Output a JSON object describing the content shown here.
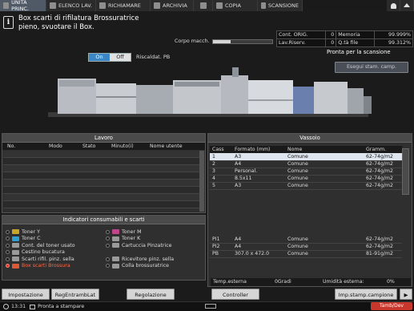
{
  "tabs": [
    {
      "label": "UNITA PRINC.",
      "icon": "machine-icon"
    },
    {
      "label": "ELENCO LAV.",
      "icon": "job-list-icon"
    },
    {
      "label": "RICHIAMARE",
      "icon": "recall-icon"
    },
    {
      "label": "ARCHIVIA",
      "icon": "store-icon"
    },
    {
      "label": "",
      "icon": "fax-icon"
    },
    {
      "label": "COPIA",
      "icon": "copy-icon"
    },
    {
      "label": "SCANSIONE",
      "icon": "scan-icon"
    }
  ],
  "alert": {
    "line1": "Box scarti di rifilatura Brossuratrice",
    "line2": "pieno, svuotare il Box."
  },
  "status": {
    "cont_orig_label": "Cont. ORIG.",
    "cont_orig_value": "0",
    "memoria_label": "Memoria",
    "memoria_value": "99.999%",
    "lav_riserv_label": "Lav.Riserv.",
    "lav_riserv_value": "0",
    "qta_file_label": "Q.tà file",
    "qta_file_value": "99.312%"
  },
  "corpo": {
    "label": "Corpo macch.",
    "fill": 0.3
  },
  "ready_scan": "Pronta per la scansione",
  "sample_btn": "Esegui stam. camp.",
  "heater": {
    "on": "On",
    "off": "Off",
    "label": "Riscaldat. PB"
  },
  "lavoro": {
    "title": "Lavoro",
    "columns": [
      "No.",
      "Modo",
      "Stato",
      "Minuto(i)",
      "Nome utente"
    ]
  },
  "consumabili": {
    "title": "Indicatori consumabili e scarti",
    "items": [
      [
        "Toner Y",
        "Toner M"
      ],
      [
        "Toner C",
        "Toner K"
      ],
      [
        "Cont. del toner usato",
        "Cartuccia Pinzatrice"
      ],
      [
        "Cestino bucatura",
        ""
      ],
      [
        "Scarti rifil. pinz. sella",
        "Ricevitore pinz. sella"
      ],
      [
        "Box scarti Brossura",
        "Colla brossuratrice"
      ]
    ]
  },
  "vassoio": {
    "title": "Vassoio",
    "columns": [
      "Cass",
      "Formato (mm)",
      "Nome",
      "Gramm."
    ],
    "rows": [
      {
        "cass": "1",
        "formato": "A3",
        "nome": "Comune",
        "gramm": "62-74g/m2"
      },
      {
        "cass": "2",
        "formato": "A4",
        "nome": "Comune",
        "gramm": "62-74g/m2"
      },
      {
        "cass": "3",
        "formato": "Personal.",
        "nome": "Comune",
        "gramm": "62-74g/m2"
      },
      {
        "cass": "4",
        "formato": "8.5x11",
        "nome": "Comune",
        "gramm": "62-74g/m2"
      },
      {
        "cass": "5",
        "formato": "A3",
        "nome": "Comune",
        "gramm": "62-74g/m2"
      }
    ],
    "rows_lower": [
      {
        "cass": "PI1",
        "formato": "A4",
        "nome": "Comune",
        "gramm": "62-74g/m2"
      },
      {
        "cass": "PI2",
        "formato": "A4",
        "nome": "Comune",
        "gramm": "62-74g/m2"
      },
      {
        "cass": "PB",
        "formato": "307.0 x 472.0",
        "nome": "Comune",
        "gramm": "81-91g/m2"
      }
    ],
    "temp_label": "Temp.esterna",
    "temp_value": "0Gradi",
    "hum_label": "Umidità esterna:",
    "hum_value": "0%"
  },
  "buttons": {
    "impostazione": "Impostazione carta",
    "regentrambl": "RegEntrambLat",
    "regolazione": "Regolazione",
    "controller": "Controller",
    "imp_stamp": "Imp.stamp.campione",
    "next": "▶"
  },
  "footer": {
    "time": "13:31",
    "status": "Pronta a stampare",
    "toner": "Tamb/Dev"
  }
}
